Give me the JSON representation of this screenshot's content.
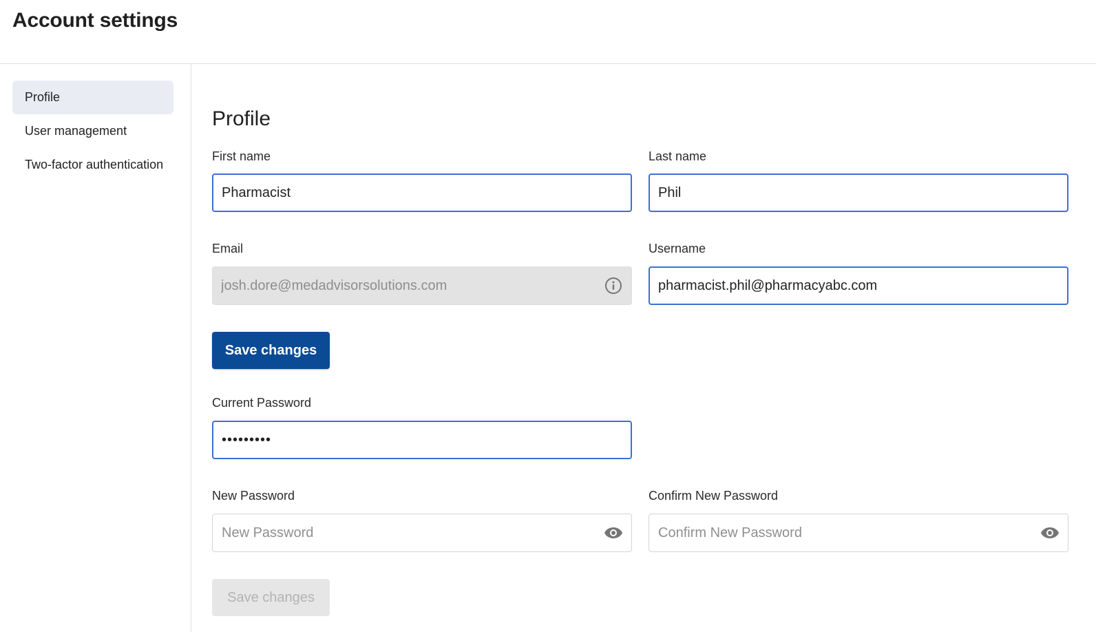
{
  "header": {
    "title": "Account settings"
  },
  "sidebar": {
    "items": [
      {
        "label": "Profile",
        "active": true
      },
      {
        "label": "User management",
        "active": false
      },
      {
        "label": "Two-factor authentication",
        "active": false
      }
    ]
  },
  "profile": {
    "title": "Profile",
    "first_name": {
      "label": "First name",
      "value": "Pharmacist"
    },
    "last_name": {
      "label": "Last name",
      "value": "Phil"
    },
    "email": {
      "label": "Email",
      "value": "josh.dore@medadvisorsolutions.com",
      "icon": "info-icon"
    },
    "username": {
      "label": "Username",
      "value": "pharmacist.phil@pharmacyabc.com"
    },
    "save_label": "Save changes"
  },
  "password": {
    "current": {
      "label": "Current Password",
      "value": "•••••••••"
    },
    "new": {
      "label": "New Password",
      "placeholder": "New Password",
      "icon": "eye-icon"
    },
    "confirm": {
      "label": "Confirm New Password",
      "placeholder": "Confirm New Password",
      "icon": "eye-icon"
    },
    "save_label": "Save changes"
  },
  "colors": {
    "accent": "#0b4a94",
    "focus_border": "#3b6fd6",
    "active_nav": "#e9edf3",
    "disabled_field": "#e3e3e3",
    "icon": "#757575"
  }
}
